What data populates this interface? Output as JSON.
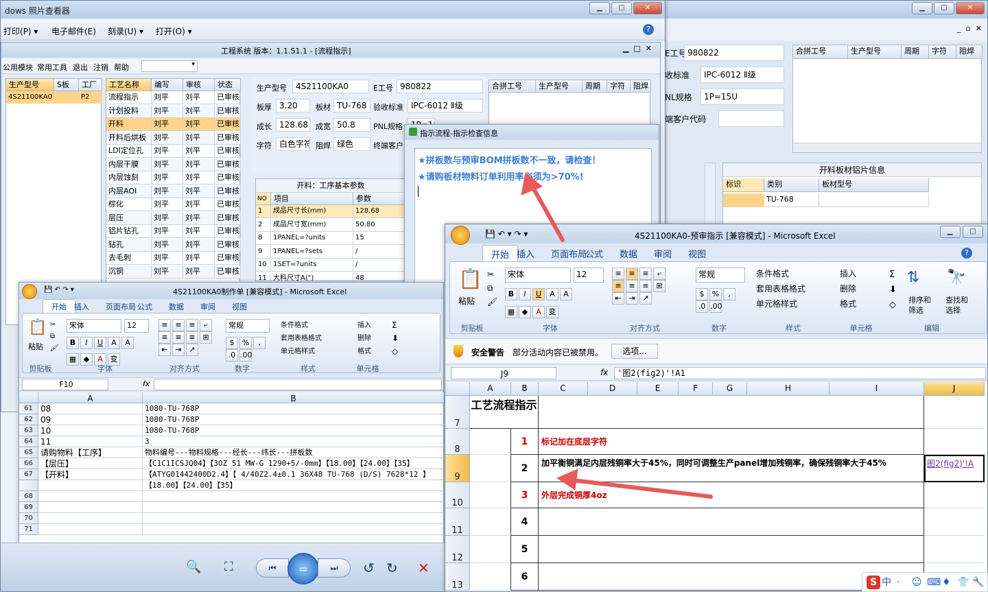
{
  "photo_viewer": {
    "title": "dows 照片查看器",
    "menu": [
      "打印(P)",
      "电子邮件(E)",
      "刻录(U)",
      "打开(O)"
    ],
    "help_icon": "question-icon"
  },
  "bg_window": {
    "fields": [
      {
        "label": "E工号",
        "value": "980822"
      },
      {
        "label": "收标准",
        "value": "IPC-6012 Ⅱ级"
      },
      {
        "label": "NL规格",
        "value": "1P=15U"
      },
      {
        "label": "端客户代码",
        "value": ""
      }
    ],
    "table_headers": [
      "合拼工号",
      "生产型号",
      "周期",
      "字符",
      "阻焊"
    ],
    "sheet_title": "开料板材铝片信息",
    "sheet_headers": [
      "标识",
      "类别",
      "板材型号"
    ],
    "sheet_rows": [
      [
        "",
        "TU-768",
        ""
      ]
    ]
  },
  "eng_system": {
    "title": "工程系统  版本：1.1.51.1 - [流程指示]",
    "menu": [
      "公用模块",
      "常用工具",
      "退出",
      "注销",
      "帮助"
    ],
    "left_headers": [
      "生产型号",
      "S板",
      "工厂"
    ],
    "left_rows": [
      [
        "4S21100KA0",
        "",
        "P2"
      ]
    ],
    "proc_headers": [
      "工艺名称",
      "编写",
      "审核",
      "状态"
    ],
    "proc_rows": [
      [
        "流程指示",
        "刘平",
        "刘平",
        "已审核"
      ],
      [
        "计划投料",
        "刘平",
        "刘平",
        "已审核"
      ],
      [
        "开料",
        "刘平",
        "刘平",
        "已审核"
      ],
      [
        "开料后烘板",
        "刘平",
        "刘平",
        "已审核"
      ],
      [
        "LDI定位孔",
        "刘平",
        "刘平",
        "已审核"
      ],
      [
        "内层干膜",
        "刘平",
        "刘平",
        "已审核"
      ],
      [
        "内层蚀刻",
        "刘平",
        "刘平",
        "已审核"
      ],
      [
        "内层AOI",
        "刘平",
        "刘平",
        "已审核"
      ],
      [
        "棕化",
        "刘平",
        "刘平",
        "已审核"
      ],
      [
        "层压",
        "刘平",
        "刘平",
        "已审核"
      ],
      [
        "铝片钻孔",
        "刘平",
        "刘平",
        "已审核"
      ],
      [
        "钻孔",
        "刘平",
        "刘平",
        "已审核"
      ],
      [
        "去毛刺",
        "刘平",
        "刘平",
        "已审核"
      ],
      [
        "沉铜",
        "刘平",
        "刘平",
        "已审核"
      ]
    ],
    "info": {
      "model_label": "生产型号",
      "model": "4S21100KA0",
      "eno_label": "E工号",
      "eno": "980822",
      "thick_label": "板厚",
      "thick": "3.20",
      "mat_label": "板材",
      "mat": "TU-768",
      "std_label": "验收标准",
      "std": "IPC-6012 Ⅱ级",
      "len_label": "成长",
      "len": "128.68",
      "wid_label": "成宽",
      "wid": "50.8",
      "pnl_label": "PNL规格",
      "pnl": "1P=15U",
      "char_label": "字符",
      "char": "白色字符",
      "mask_label": "阻焊",
      "mask": "绿色",
      "cust_label": "终端客户"
    },
    "right_headers": [
      "合拼工号",
      "生产型号",
      "周期",
      "字符",
      "阻焊"
    ],
    "param_title": "开料：工序基本参数",
    "param_headers": [
      "NO",
      "项目",
      "参数"
    ],
    "param_rows": [
      [
        "1",
        "成品尺寸长(mm)",
        "128.68"
      ],
      [
        "2",
        "成品尺寸宽(mm)",
        "50.80"
      ],
      [
        "8",
        "1PANEL=?units",
        "15"
      ],
      [
        "9",
        "1PANEL=?sets",
        "/"
      ],
      [
        "10",
        "1SET=?units",
        "/"
      ],
      [
        "11",
        "大料尺寸A(\")",
        "48"
      ]
    ]
  },
  "dialog": {
    "title": "指示流程-指示检查信息",
    "messages": [
      "★拼板数与预审BOM拼板数不一致，请检查！",
      "★请购板材物料订单利用率必须为>70%!"
    ]
  },
  "excel_left": {
    "title": "4S21100KA0制作单  [兼容模式] - Microsoft Excel",
    "tabs": [
      "开始",
      "插入",
      "页面布局",
      "公式",
      "数据",
      "审阅",
      "视图"
    ],
    "font": "宋体",
    "size": "12",
    "numfmt": "常规",
    "groups": [
      "剪贴板",
      "字体",
      "对齐方式",
      "数字",
      "样式",
      "单元格"
    ],
    "paste": "粘贴",
    "styles": [
      "条件格式",
      "套用表格格式",
      "单元格样式"
    ],
    "cells": [
      "插入",
      "删除",
      "格式"
    ],
    "namebox": "F10",
    "cols": [
      "A",
      "B"
    ],
    "rows": [
      {
        "n": "61",
        "a": "08",
        "b": "1080-TU-768P"
      },
      {
        "n": "62",
        "a": "09",
        "b": "1080-TU-768P"
      },
      {
        "n": "63",
        "a": "10",
        "b": "1080-TU-768P"
      },
      {
        "n": "64",
        "a": "11",
        "b": "3"
      },
      {
        "n": "65",
        "a": "请购物料【工序】",
        "b": "物料编号---物料规格---经长---纬长---拼板数"
      },
      {
        "n": "66",
        "a": "【层压】",
        "b": "【C1C1ICSJQ04】【3OZ 51 MW-G 1290+5/-0mm】【18.00】【24.00】【35】"
      },
      {
        "n": "67",
        "a": "【开料】",
        "b": "【ATYG01442400D2.4】【 4/40Z2.4±0.1 36X48  TU-768 (D/S)  7628*12 】"
      },
      {
        "n": "",
        "a": "",
        "b": "【18.00】【24.00】【35】"
      },
      {
        "n": "68",
        "a": "",
        "b": ""
      },
      {
        "n": "69",
        "a": "",
        "b": ""
      },
      {
        "n": "70",
        "a": "",
        "b": ""
      },
      {
        "n": "71",
        "a": "",
        "b": ""
      }
    ]
  },
  "excel_right": {
    "title": "4S21100KA0-预审指示  [兼容模式] - Microsoft Excel",
    "tabs": [
      "开始",
      "插入",
      "页面布局",
      "公式",
      "数据",
      "审阅",
      "视图"
    ],
    "font": "宋体",
    "size": "12",
    "numfmt": "常规",
    "groups": [
      "剪贴板",
      "字体",
      "对齐方式",
      "数字",
      "样式",
      "单元格",
      "编辑"
    ],
    "paste": "粘贴",
    "styles": [
      "条件格式",
      "套用表格格式",
      "单元格样式"
    ],
    "cells": [
      "插入",
      "删除",
      "格式"
    ],
    "edit": [
      "排序和筛选",
      "查找和选择"
    ],
    "security_label": "安全警告",
    "security_text": "部分活动内容已被禁用。",
    "options_button": "选项...",
    "namebox": "J9",
    "formula": "'图2(fig2)'!A1",
    "cols": [
      "A",
      "B",
      "C",
      "D",
      "E",
      "F",
      "G",
      "H",
      "I",
      "J"
    ],
    "header_cell": "工艺流程指示",
    "rows": [
      {
        "n": "7",
        "b": "",
        "c": "",
        "j": ""
      },
      {
        "n": "8",
        "b": "1",
        "c": "标记加在底层字符",
        "j": ""
      },
      {
        "n": "9",
        "b": "2",
        "c": "加平衡铜满足内层残铜率大于45%，同时可调整生产panel增加残铜率，确保残铜率大于45%",
        "j": "图2(fig2)'!A"
      },
      {
        "n": "10",
        "b": "3",
        "c": "外层完成铜厚4oz",
        "j": ""
      },
      {
        "n": "11",
        "b": "4",
        "c": "",
        "j": ""
      },
      {
        "n": "12",
        "b": "5",
        "c": "",
        "j": ""
      },
      {
        "n": "13",
        "b": "6",
        "c": "",
        "j": ""
      }
    ]
  },
  "taskbar_ime": [
    "S",
    "中",
    "·",
    "☺",
    "⌨",
    "♦",
    "👕",
    "🔧"
  ],
  "colors": {
    "accent": "#15428b",
    "red": "#cc0000",
    "arrow": "#e85a5a",
    "selected": "#ffd48a",
    "dialog_text": "#3d7fd1"
  }
}
